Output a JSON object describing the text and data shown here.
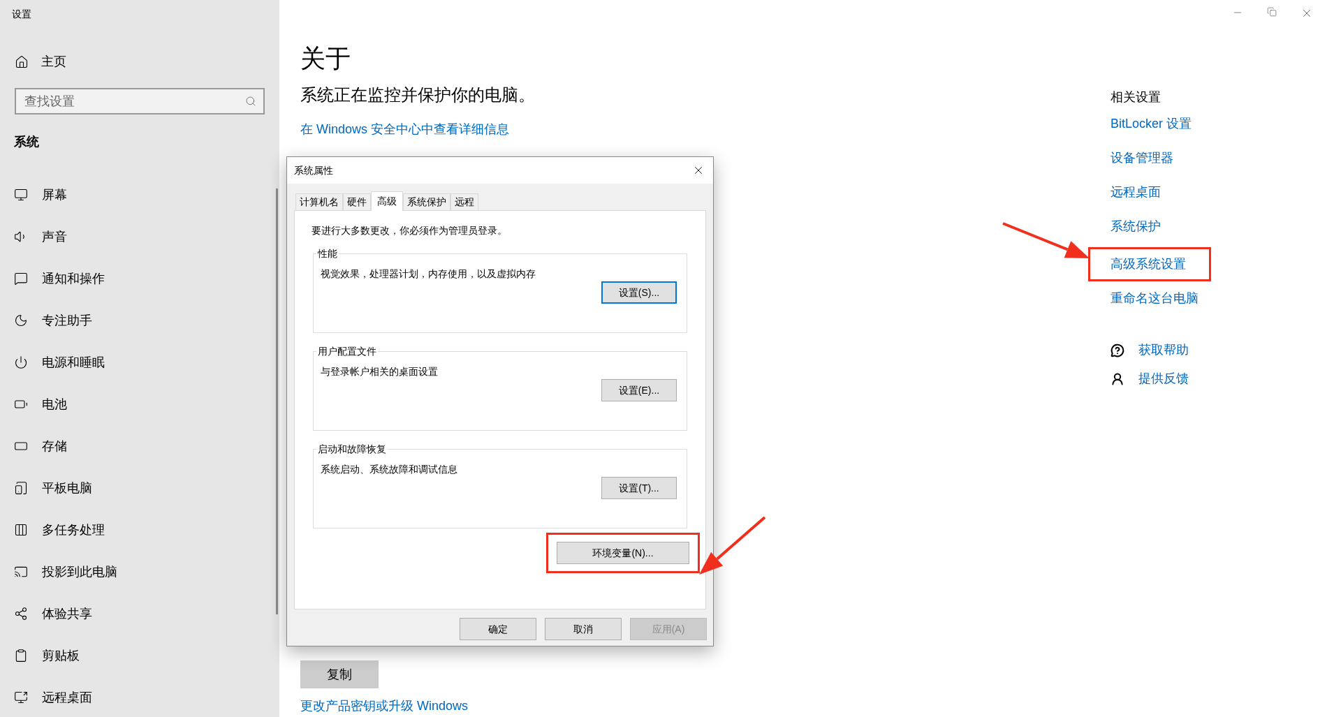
{
  "window": {
    "title": "设置"
  },
  "sidebar": {
    "home": "主页",
    "search": {
      "placeholder": "查找设置"
    },
    "section": "系统",
    "items": [
      {
        "label": "屏幕"
      },
      {
        "label": "声音"
      },
      {
        "label": "通知和操作"
      },
      {
        "label": "专注助手"
      },
      {
        "label": "电源和睡眠"
      },
      {
        "label": "电池"
      },
      {
        "label": "存储"
      },
      {
        "label": "平板电脑"
      },
      {
        "label": "多任务处理"
      },
      {
        "label": "投影到此电脑"
      },
      {
        "label": "体验共享"
      },
      {
        "label": "剪贴板"
      },
      {
        "label": "远程桌面"
      }
    ]
  },
  "page": {
    "title": "关于",
    "status": "系统正在监控并保护你的电脑。",
    "security_link": "在 Windows 安全中心中查看详细信息",
    "copy_button": "复制",
    "upgrade_link": "更改产品密钥或升级 Windows"
  },
  "related": {
    "heading": "相关设置",
    "links": [
      {
        "label": "BitLocker 设置",
        "highlighted": false
      },
      {
        "label": "设备管理器",
        "highlighted": false
      },
      {
        "label": "远程桌面",
        "highlighted": false
      },
      {
        "label": "系统保护",
        "highlighted": false
      },
      {
        "label": "高级系统设置",
        "highlighted": true
      },
      {
        "label": "重命名这台电脑",
        "highlighted": false
      }
    ],
    "support": [
      {
        "label": "获取帮助"
      },
      {
        "label": "提供反馈"
      }
    ]
  },
  "dialog": {
    "title": "系统属性",
    "tabs": [
      {
        "label": "计算机名",
        "selected": false
      },
      {
        "label": "硬件",
        "selected": false
      },
      {
        "label": "高级",
        "selected": true
      },
      {
        "label": "系统保护",
        "selected": false
      },
      {
        "label": "远程",
        "selected": false
      }
    ],
    "notice": "要进行大多数更改，你必须作为管理员登录。",
    "groups": [
      {
        "title": "性能",
        "description": "视觉效果，处理器计划，内存使用，以及虚拟内存",
        "button": "设置(S)...",
        "focused": true
      },
      {
        "title": "用户配置文件",
        "description": "与登录帐户相关的桌面设置",
        "button": "设置(E)...",
        "focused": false
      },
      {
        "title": "启动和故障恢复",
        "description": "系统启动、系统故障和调试信息",
        "button": "设置(T)...",
        "focused": false
      }
    ],
    "env_button": {
      "label": "环境变量(N)...",
      "highlighted": true
    },
    "footer_buttons": [
      {
        "label": "确定",
        "disabled": false
      },
      {
        "label": "取消",
        "disabled": false
      },
      {
        "label": "应用(A)",
        "disabled": true
      }
    ]
  }
}
